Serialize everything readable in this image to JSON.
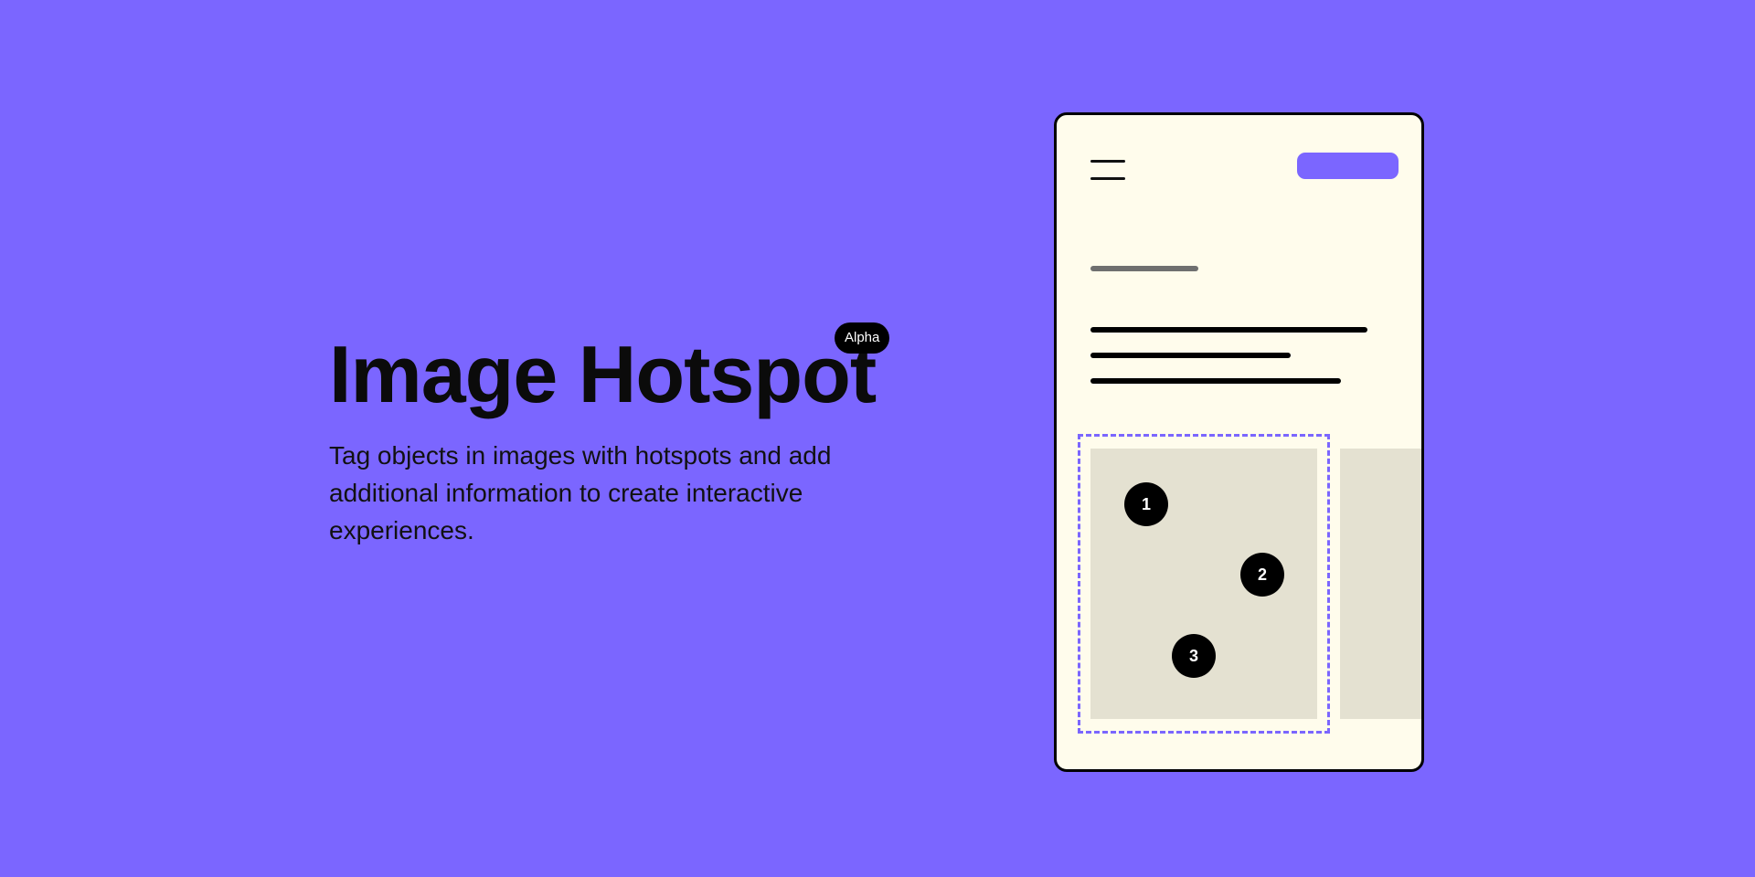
{
  "hero": {
    "title": "Image Hotspot",
    "badge": "Alpha",
    "description": "Tag objects in images with hotspots and add additional information to create interactive experiences."
  },
  "mockup": {
    "menu_icon": "hamburger-icon",
    "hotspots": [
      "1",
      "2",
      "3"
    ]
  },
  "colors": {
    "background": "#7B66FF",
    "phone_background": "#FFFCEC",
    "image_placeholder": "#E4E1D1",
    "accent": "#7B66FF"
  }
}
